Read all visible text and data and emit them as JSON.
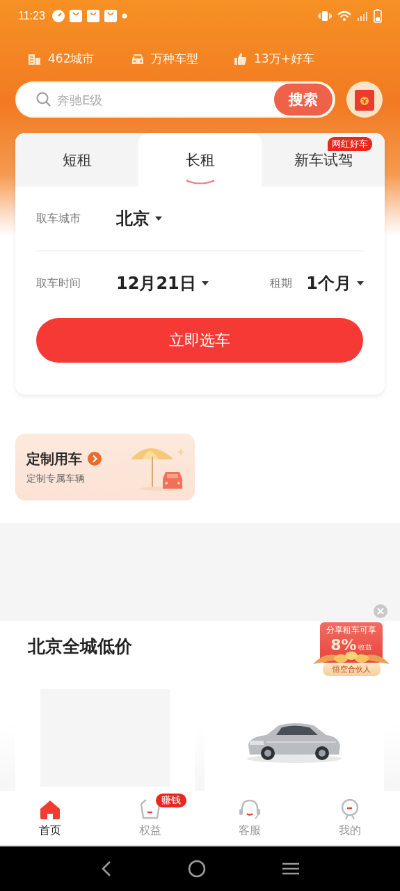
{
  "status_bar": {
    "time": "11:23"
  },
  "stats": [
    {
      "kind": "city",
      "text": "462城市"
    },
    {
      "kind": "car",
      "text": "万种车型"
    },
    {
      "kind": "thumb",
      "text": "13万+好车"
    }
  ],
  "search": {
    "placeholder": "奔驰E级",
    "button": "搜索"
  },
  "tabs": [
    {
      "label": "短租",
      "selected": false
    },
    {
      "label": "长租",
      "selected": true
    },
    {
      "label": "新车试驾",
      "selected": false,
      "badge": "网红好车"
    }
  ],
  "form": {
    "city_label": "取车城市",
    "city": "北京",
    "time_label": "取车时间",
    "date": "12月21日",
    "period_label": "租期",
    "period": "1个月",
    "submit": "立即选车"
  },
  "promo": {
    "title": "定制用车",
    "subtitle": "定制专属车辆"
  },
  "section": {
    "title": "北京全城低价",
    "badge": {
      "line": "分享租车可享",
      "percent": "8%",
      "suffix": "收益",
      "footer": "悟空合伙人"
    }
  },
  "cards": [
    {
      "kind": "placeholder"
    },
    {
      "kind": "picture"
    }
  ],
  "bottom_tabs": [
    {
      "kind": "home",
      "label": "首页",
      "selected": true
    },
    {
      "kind": "basket",
      "label": "权益",
      "selected": false,
      "badge": "赚钱"
    },
    {
      "kind": "headset",
      "label": "客服",
      "selected": false
    },
    {
      "kind": "person",
      "label": "我的",
      "selected": false
    }
  ]
}
